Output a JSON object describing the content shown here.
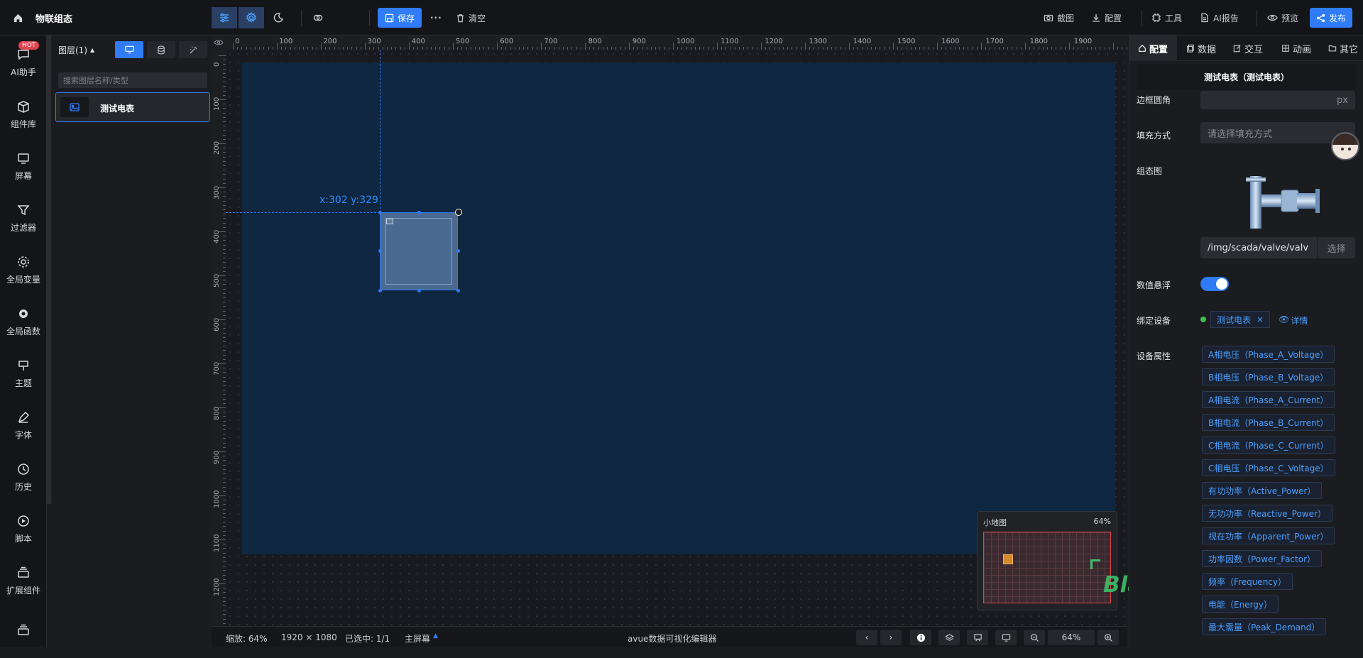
{
  "app": {
    "title": "物联组态"
  },
  "toolbar": {
    "save": "保存",
    "more": "···",
    "clear": "清空",
    "screenshot": "截图",
    "config": "配置",
    "tools": "工具",
    "ai_report": "AI报告",
    "preview": "预览",
    "publish": "发布"
  },
  "nav": {
    "hot": "HOT",
    "items": [
      {
        "label": "AI助手",
        "icon": "chat-icon"
      },
      {
        "label": "组件库",
        "icon": "package-icon"
      },
      {
        "label": "屏幕",
        "icon": "monitor-icon"
      },
      {
        "label": "过滤器",
        "icon": "filter-icon"
      },
      {
        "label": "全局变量",
        "icon": "gear-icon"
      },
      {
        "label": "全局函数",
        "icon": "cog-filled-icon"
      },
      {
        "label": "主题",
        "icon": "brush-icon"
      },
      {
        "label": "字体",
        "icon": "pen-icon"
      },
      {
        "label": "历史",
        "icon": "clock-icon"
      },
      {
        "label": "脚本",
        "icon": "play-icon"
      },
      {
        "label": "扩展组件",
        "icon": "stack-icon"
      },
      {
        "label": "",
        "icon": "stack-icon"
      }
    ]
  },
  "layers": {
    "title": "图层(1)",
    "search_placeholder": "搜索图层名称/类型",
    "items": [
      {
        "name": "测试电表"
      }
    ]
  },
  "canvas": {
    "ruler_h": [
      "0",
      "100",
      "200",
      "300",
      "400",
      "500",
      "600",
      "700",
      "800",
      "900",
      "1000",
      "1100",
      "1200",
      "1300",
      "1400",
      "1500",
      "1600",
      "1700",
      "1800",
      "1900"
    ],
    "ruler_v": [
      "0",
      "100",
      "200",
      "300",
      "400",
      "500",
      "600",
      "700",
      "800",
      "900",
      "1000",
      "1100",
      "1200"
    ],
    "coord_label": "x:302 y:329",
    "bg_color": "#0f2740",
    "minimap": {
      "title": "小地图",
      "zoom": "64%"
    },
    "watermark": "Blade技术社区"
  },
  "statusbar": {
    "zoom": "缩放: 64%",
    "size": "1920 × 1080",
    "selected": "已选中: 1/1",
    "screen": "主屏幕",
    "center": "avue数据可视化编辑器",
    "zoom_value": "64%"
  },
  "right": {
    "tabs": [
      "配置",
      "数据",
      "交互",
      "动画",
      "其它"
    ],
    "component_title": "测试电表（测试电表）",
    "fields": {
      "radius_label": "边框圆角",
      "radius_unit": "px",
      "fill_label": "填充方式",
      "fill_placeholder": "请选择填充方式",
      "image_label": "组态图",
      "image_path": "/img/scada/valve/valv",
      "choose": "选择",
      "float_label": "数值悬浮",
      "bind_label": "绑定设备",
      "device": "测试电表",
      "detail": "详情",
      "attr_label": "设备属性"
    },
    "attributes": [
      "A相电压（Phase_A_Voltage）",
      "B相电压（Phase_B_Voltage）",
      "A相电流（Phase_A_Current）",
      "B相电流（Phase_B_Current）",
      "C相电流（Phase_C_Current）",
      "C相电压（Phase_C_Voltage）",
      "有功功率（Active_Power）",
      "无功功率（Reactive_Power）",
      "视在功率（Apparent_Power）",
      "功率因数（Power_Factor）",
      "频率（Frequency）",
      "电能（Energy）",
      "最大需量（Peak_Demand）"
    ]
  },
  "colors": {
    "accent": "#2f7cf6",
    "canvas": "#0f2740",
    "panel": "#1b1c20"
  }
}
